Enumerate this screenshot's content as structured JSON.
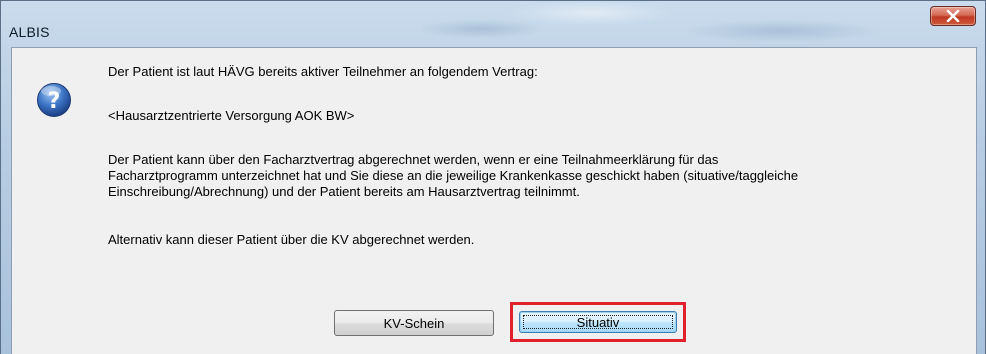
{
  "window": {
    "title": "ALBIS",
    "close_symbol": "x"
  },
  "dialog": {
    "icon": "question-icon",
    "line1": "Der Patient ist laut HÄVG bereits aktiver Teilnehmer an folgendem Vertrag:",
    "line2": "<Hausarztzentrierte Versorgung AOK BW>",
    "para3": [
      "Der Patient kann über den Facharztvertrag abgerechnet werden, wenn er eine Teilnahmeerklärung für das",
      "Facharztprogramm unterzeichnet hat und Sie diese an die jeweilige Krankenkasse geschickt haben (situative/taggleiche",
      "Einschreibung/Abrechnung) und der Patient bereits am Hausarztvertrag teilnimmt."
    ],
    "para4": "Alternativ kann dieser Patient über die KV abgerechnet werden."
  },
  "buttons": {
    "kv_schein": "KV-Schein",
    "situativ": "Situativ"
  },
  "colors": {
    "highlight_border": "#e0202a",
    "close_button": "#c03a23",
    "default_button": "#bee6fd"
  }
}
